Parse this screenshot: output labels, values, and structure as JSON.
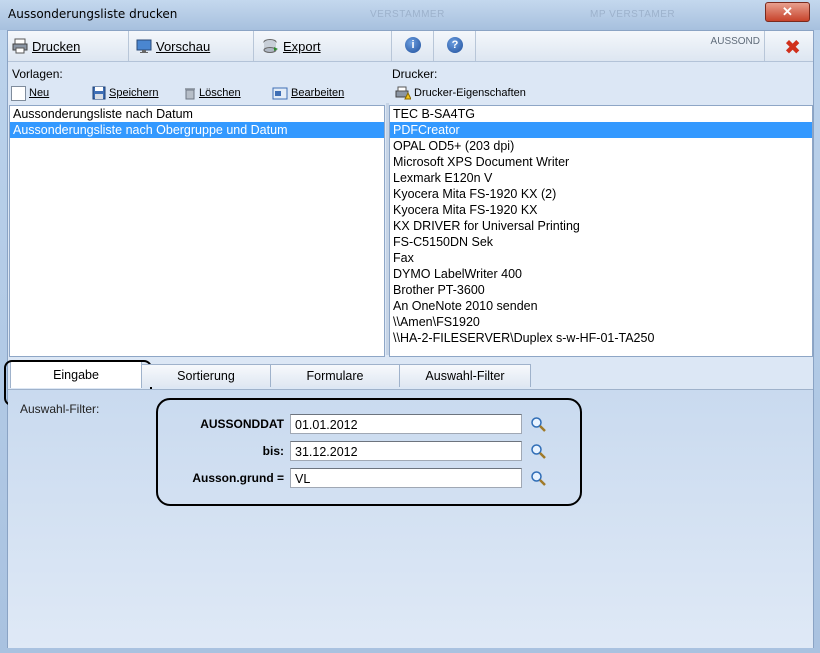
{
  "window": {
    "title": "Aussonderungsliste drucken",
    "ghost_tabs": [
      "VERSTAMMER",
      "MP VERSTAMER"
    ]
  },
  "toolbar": {
    "print_label": "Drucken",
    "preview_label": "Vorschau",
    "export_label": "Export",
    "module_label": "AUSSOND"
  },
  "templates": {
    "caption": "Vorlagen:",
    "new_label": "Neu",
    "save_label": "Speichern",
    "delete_label": "Löschen",
    "edit_label": "Bearbeiten",
    "items": [
      {
        "label": "Aussonderungsliste nach Datum",
        "selected": false
      },
      {
        "label": "Aussonderungsliste nach Obergruppe und Datum",
        "selected": true
      }
    ]
  },
  "printers": {
    "caption": "Drucker:",
    "properties_label": "Drucker-Eigenschaften",
    "items": [
      {
        "label": "TEC B-SA4TG",
        "selected": false
      },
      {
        "label": "PDFCreator",
        "selected": true
      },
      {
        "label": "OPAL OD5+ (203 dpi)",
        "selected": false
      },
      {
        "label": "Microsoft XPS Document Writer",
        "selected": false
      },
      {
        "label": "Lexmark E120n V",
        "selected": false
      },
      {
        "label": "Kyocera Mita FS-1920 KX (2)",
        "selected": false
      },
      {
        "label": "Kyocera Mita FS-1920 KX",
        "selected": false
      },
      {
        "label": "KX DRIVER for Universal Printing",
        "selected": false
      },
      {
        "label": "FS-C5150DN Sek",
        "selected": false
      },
      {
        "label": "Fax",
        "selected": false
      },
      {
        "label": "DYMO LabelWriter 400",
        "selected": false
      },
      {
        "label": "Brother PT-3600",
        "selected": false
      },
      {
        "label": "An OneNote 2010 senden",
        "selected": false
      },
      {
        "label": "\\\\Amen\\FS1920",
        "selected": false
      },
      {
        "label": "\\\\HA-2-FILESERVER\\Duplex s-w-HF-01-TA250",
        "selected": false
      }
    ]
  },
  "tabs": [
    {
      "label": "Eingabe",
      "active": true
    },
    {
      "label": "Sortierung",
      "active": false
    },
    {
      "label": "Formulare",
      "active": false
    },
    {
      "label": "Auswahl-Filter",
      "active": false
    }
  ],
  "filter": {
    "caption": "Auswahl-Filter:",
    "fields": [
      {
        "label": "AUSSONDDAT",
        "value": "01.01.2012"
      },
      {
        "label": "bis:",
        "value": "31.12.2012"
      },
      {
        "label": "Ausson.grund =",
        "value": "VL"
      }
    ]
  },
  "colors": {
    "selection": "#3399ff",
    "annotation": "#000000",
    "close": "#d0301c"
  },
  "icons": [
    "printer-icon",
    "monitor-icon",
    "database-export-icon",
    "info-icon",
    "help-icon",
    "close-icon",
    "checkbox-icon",
    "floppy-icon",
    "trash-icon",
    "edit-icon",
    "printer-warning-icon",
    "magnifier-icon"
  ]
}
